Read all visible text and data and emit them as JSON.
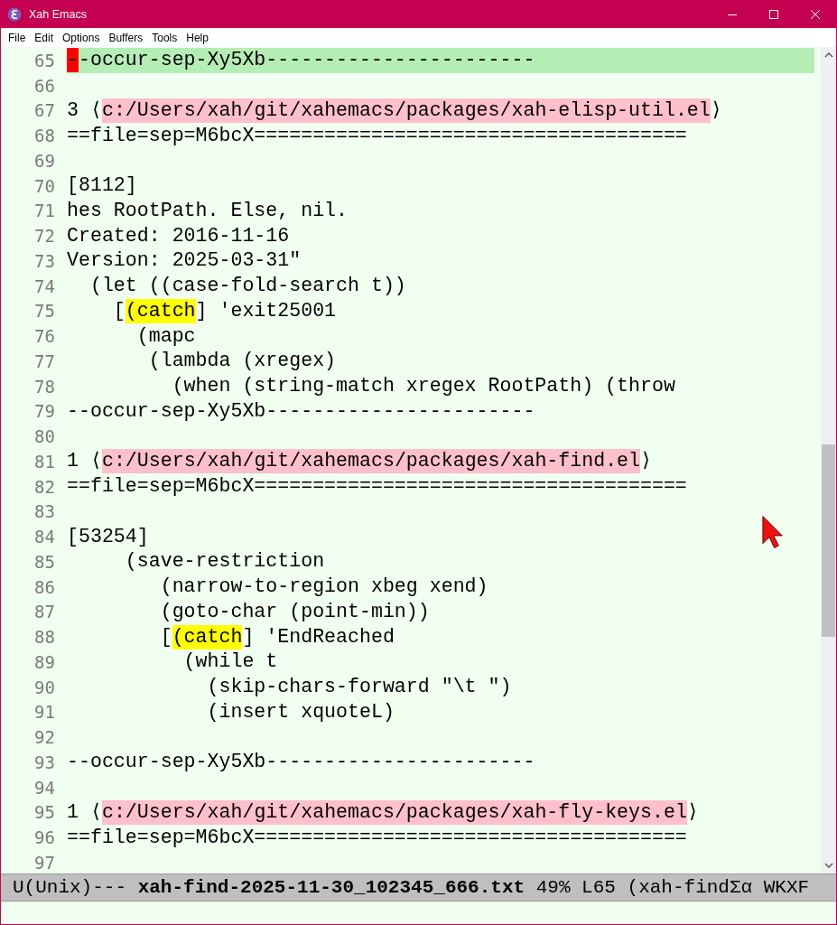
{
  "window": {
    "title": "Xah Emacs"
  },
  "menu": [
    "File",
    "Edit",
    "Options",
    "Buffers",
    "Tools",
    "Help"
  ],
  "lines": [
    {
      "number": "65",
      "current": true,
      "segments": [
        {
          "kind": "cursor",
          "text": "-"
        },
        {
          "kind": "plain",
          "text": "-occur-sep-Xy5Xb-----------------------"
        }
      ]
    },
    {
      "number": "66",
      "current": false
    },
    {
      "number": "67",
      "current": false,
      "segments": [
        {
          "kind": "plain",
          "text": "3 ⟨"
        },
        {
          "kind": "path",
          "text": "c:/Users/xah/git/xahemacs/packages/xah-elisp-util.el"
        },
        {
          "kind": "plain",
          "text": "⟩"
        }
      ]
    },
    {
      "number": "68",
      "current": false,
      "segments": [
        {
          "kind": "plain",
          "text": "==file=sep=M6bcX====================================="
        }
      ]
    },
    {
      "number": "69",
      "current": false
    },
    {
      "number": "70",
      "current": false,
      "segments": [
        {
          "kind": "plain",
          "text": "[8112]"
        }
      ]
    },
    {
      "number": "71",
      "current": false,
      "segments": [
        {
          "kind": "plain",
          "text": "hes RootPath. Else, nil."
        }
      ]
    },
    {
      "number": "72",
      "current": false,
      "segments": [
        {
          "kind": "plain",
          "text": "Created: 2016-11-16"
        }
      ]
    },
    {
      "number": "73",
      "current": false,
      "segments": [
        {
          "kind": "plain",
          "text": "Version: 2025-03-31\""
        }
      ]
    },
    {
      "number": "74",
      "current": false,
      "segments": [
        {
          "kind": "plain",
          "text": "  (let ((case-fold-search t))"
        }
      ]
    },
    {
      "number": "75",
      "current": false,
      "segments": [
        {
          "kind": "plain",
          "text": "    ["
        },
        {
          "kind": "match",
          "text": "(catch"
        },
        {
          "kind": "plain",
          "text": "] 'exit25001"
        }
      ]
    },
    {
      "number": "76",
      "current": false,
      "segments": [
        {
          "kind": "plain",
          "text": "      (mapc"
        }
      ]
    },
    {
      "number": "77",
      "current": false,
      "segments": [
        {
          "kind": "plain",
          "text": "       (lambda (xregex)"
        }
      ]
    },
    {
      "number": "78",
      "current": false,
      "segments": [
        {
          "kind": "plain",
          "text": "         (when (string-match xregex RootPath) (throw"
        }
      ]
    },
    {
      "number": "79",
      "current": false,
      "segments": [
        {
          "kind": "plain",
          "text": "--occur-sep-Xy5Xb-----------------------"
        }
      ]
    },
    {
      "number": "80",
      "current": false
    },
    {
      "number": "81",
      "current": false,
      "segments": [
        {
          "kind": "plain",
          "text": "1 ⟨"
        },
        {
          "kind": "path",
          "text": "c:/Users/xah/git/xahemacs/packages/xah-find.el"
        },
        {
          "kind": "plain",
          "text": "⟩"
        }
      ]
    },
    {
      "number": "82",
      "current": false,
      "segments": [
        {
          "kind": "plain",
          "text": "==file=sep=M6bcX====================================="
        }
      ]
    },
    {
      "number": "83",
      "current": false
    },
    {
      "number": "84",
      "current": false,
      "segments": [
        {
          "kind": "plain",
          "text": "[53254]"
        }
      ]
    },
    {
      "number": "85",
      "current": false,
      "segments": [
        {
          "kind": "plain",
          "text": "     (save-restriction"
        }
      ]
    },
    {
      "number": "86",
      "current": false,
      "segments": [
        {
          "kind": "plain",
          "text": "        (narrow-to-region xbeg xend)"
        }
      ]
    },
    {
      "number": "87",
      "current": false,
      "segments": [
        {
          "kind": "plain",
          "text": "        (goto-char (point-min))"
        }
      ]
    },
    {
      "number": "88",
      "current": false,
      "segments": [
        {
          "kind": "plain",
          "text": "        ["
        },
        {
          "kind": "match",
          "text": "(catch"
        },
        {
          "kind": "plain",
          "text": "] 'EndReached"
        }
      ]
    },
    {
      "number": "89",
      "current": false,
      "segments": [
        {
          "kind": "plain",
          "text": "          (while t"
        }
      ]
    },
    {
      "number": "90",
      "current": false,
      "segments": [
        {
          "kind": "plain",
          "text": "            (skip-chars-forward \"\\t \")"
        }
      ]
    },
    {
      "number": "91",
      "current": false,
      "segments": [
        {
          "kind": "plain",
          "text": "            (insert xquoteL)"
        }
      ]
    },
    {
      "number": "92",
      "current": false
    },
    {
      "number": "93",
      "current": false,
      "segments": [
        {
          "kind": "plain",
          "text": "--occur-sep-Xy5Xb-----------------------"
        }
      ]
    },
    {
      "number": "94",
      "current": false
    },
    {
      "number": "95",
      "current": false,
      "segments": [
        {
          "kind": "plain",
          "text": "1 ⟨"
        },
        {
          "kind": "path",
          "text": "c:/Users/xah/git/xahemacs/packages/xah-fly-keys.el"
        },
        {
          "kind": "plain",
          "text": "⟩"
        }
      ]
    },
    {
      "number": "96",
      "current": false,
      "segments": [
        {
          "kind": "plain",
          "text": "==file=sep=M6bcX====================================="
        }
      ]
    },
    {
      "number": "97",
      "current": false
    }
  ],
  "mode_line": "U(Unix)--- **xah-find-2025-11-30_102345_666.txt** 49% L65 (xah-findΣα WKXF"
}
